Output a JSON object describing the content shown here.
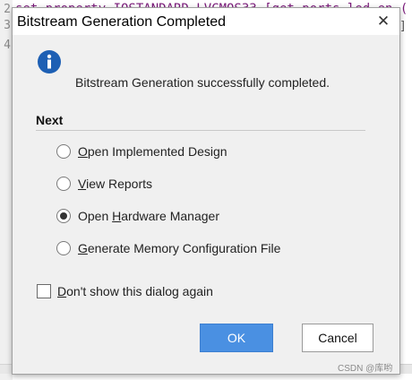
{
  "editor": {
    "line_numbers": [
      "2",
      "3",
      "4"
    ],
    "code_text": "set_property IOSTANDARD LVCMOS33 [get_ports led_en_(",
    "code_right": "]"
  },
  "dialog": {
    "title": "Bitstream Generation Completed",
    "close_glyph": "✕",
    "message": "Bitstream Generation successfully completed.",
    "section_label": "Next",
    "options": [
      {
        "prefix": "",
        "accel": "O",
        "rest": "pen Implemented Design",
        "selected": false
      },
      {
        "prefix": "",
        "accel": "V",
        "rest": "iew Reports",
        "selected": false
      },
      {
        "prefix": "Open ",
        "accel": "H",
        "rest": "ardware Manager",
        "selected": true
      },
      {
        "prefix": "",
        "accel": "G",
        "rest": "enerate Memory Configuration File",
        "selected": false
      }
    ],
    "checkbox": {
      "accel": "D",
      "rest": "on't show this dialog again",
      "checked": false
    },
    "ok_label": "OK",
    "cancel_label": "Cancel"
  },
  "watermark": "CSDN @库哟",
  "colors": {
    "accent": "#4a90e2",
    "info_icon": "#1d5fb4",
    "dialog_bg": "#f0f0f0"
  },
  "icons": {
    "info": "info-icon",
    "close": "close-icon"
  }
}
